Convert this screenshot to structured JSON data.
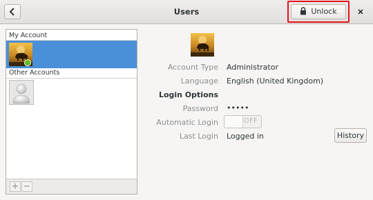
{
  "header": {
    "title": "Users",
    "unlock_label": "Unlock",
    "close_glyph": "×"
  },
  "sidebar": {
    "sections": [
      {
        "label": "My Account"
      },
      {
        "label": "Other Accounts"
      }
    ],
    "add_glyph": "+",
    "remove_glyph": "−"
  },
  "details": {
    "account_type": {
      "label": "Account Type",
      "value": "Administrator"
    },
    "language": {
      "label": "Language",
      "value": "English (United Kingdom)"
    },
    "login_options_heading": "Login Options",
    "password": {
      "label": "Password",
      "value": "•••••"
    },
    "automatic_login": {
      "label": "Automatic Login",
      "state": "OFF"
    },
    "last_login": {
      "label": "Last Login",
      "value": "Logged in"
    },
    "history_label": "History"
  },
  "colors": {
    "selection": "#4a90d9",
    "highlight_border": "#e3121b",
    "online_dot": "#5fb91d"
  },
  "icons": {
    "back": "chevron-left-icon",
    "lock": "lock-icon",
    "close": "close-icon",
    "default_avatar": "person-silhouette-icon"
  }
}
